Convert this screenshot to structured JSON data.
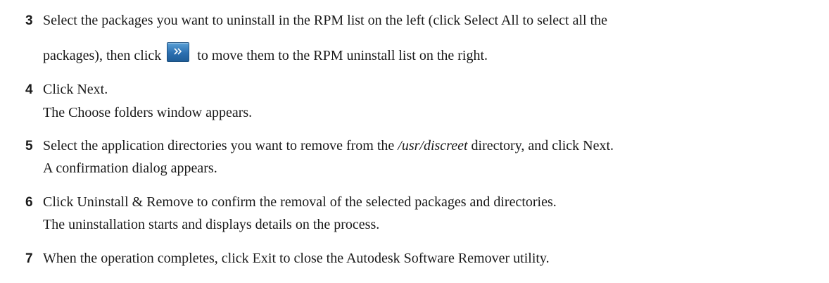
{
  "steps": [
    {
      "number": "3",
      "line1": "Select the packages you want to uninstall in the RPM list on the left (click Select All to select all the",
      "line2_before": "packages), then click",
      "button_icon": "double-chevron-right-icon",
      "line2_after": "to move them to the RPM uninstall list on the right."
    },
    {
      "number": "4",
      "line1": "Click Next.",
      "line2": "The Choose folders window appears."
    },
    {
      "number": "5",
      "line1_before": "Select the application directories you want to remove from the",
      "line1_path": "/usr/discreet",
      "line1_after": "directory, and click Next.",
      "line2": "A confirmation dialog appears."
    },
    {
      "number": "6",
      "line1": "Click Uninstall & Remove to confirm the removal of the selected packages and directories.",
      "line2": "The uninstallation starts and displays details on the process."
    },
    {
      "number": "7",
      "line1": "When the operation completes, click Exit to close the Autodesk Software Remover utility."
    }
  ],
  "colors": {
    "text": "#1a1a1a",
    "button_blue": "#2b6fb0"
  }
}
